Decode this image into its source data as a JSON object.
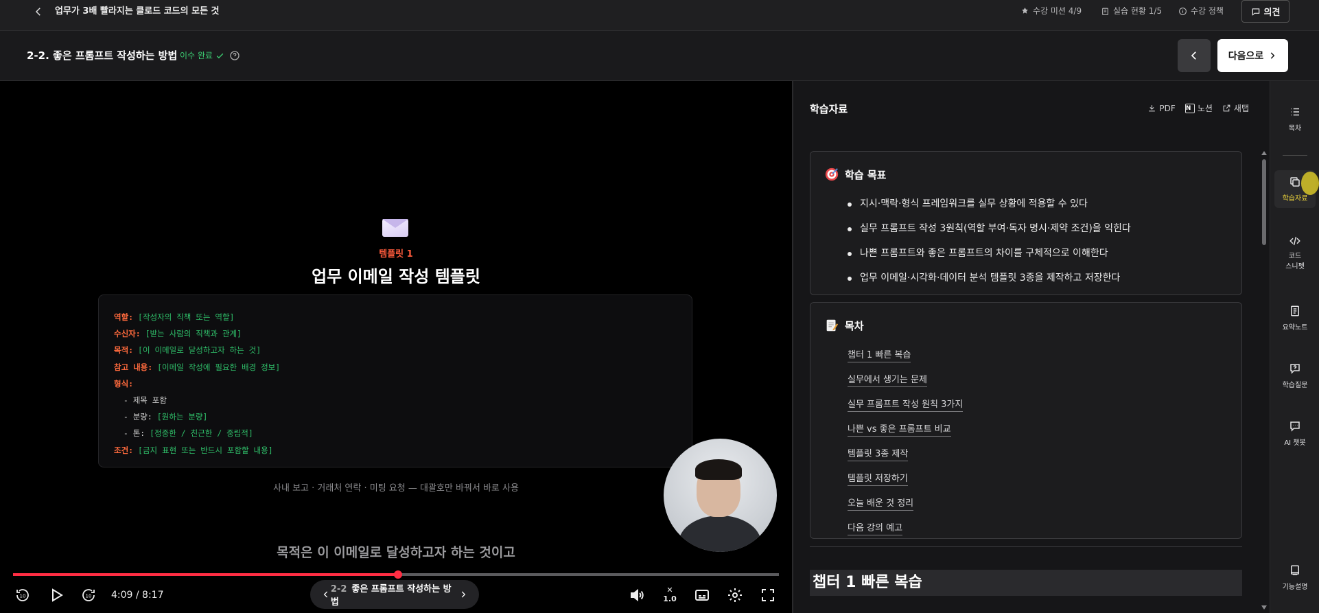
{
  "topbar": {
    "course_title": "업무가 3배 빨라지는 클로드 코드의 모든 것",
    "mission": "수강 미션 4/9",
    "practice": "실습 현황 1/5",
    "policy": "수강 정책",
    "feedback": "의견"
  },
  "lesson": {
    "title": "2-2. 좋은 프롬프트 작성하는 방법",
    "status": "이수 완료",
    "next_label": "다음으로"
  },
  "video": {
    "template_label": "템플릿 1",
    "template_title": "업무 이메일 작성 템플릿",
    "code_lines": [
      {
        "key": "역할:",
        "value": "[작성자의 직책 또는 역할]"
      },
      {
        "key": "수신자:",
        "value": "[받는 사람의 직책과 관계]"
      },
      {
        "key": "목적:",
        "value": "[이 이메일로 달성하고자 하는 것]"
      },
      {
        "key": "참고 내용:",
        "value": "[이메일 작성에 필요한 배경 정보]"
      },
      {
        "key": "형식:",
        "value": ""
      },
      {
        "key": "",
        "sub": "- 제목 포함",
        "value": ""
      },
      {
        "key": "",
        "sub": "- 분량:",
        "value": "[원하는 분량]"
      },
      {
        "key": "",
        "sub": "- 톤:",
        "value": "[정중한 / 친근한 / 중립적]"
      },
      {
        "key": "조건:",
        "value": "[금지 표현 또는 반드시 포함할 내용]"
      }
    ],
    "usage_caption": "사내 보고 · 거래처 연락 · 미팅 요청 — 대괄호만 바꿔서 바로 사용",
    "subtitle": "목적은 이 이메일로 달성하고자 하는 것이고",
    "time": "4:09 / 8:17",
    "progress": 0.503,
    "chapter_num": "2-2",
    "chapter_name": "좋은 프롬프트 작성하는 방법",
    "speed": "1.0"
  },
  "panel": {
    "title": "학습자료",
    "tools": {
      "pdf": "PDF",
      "notion": "노션",
      "new_window": "새탭"
    },
    "goals_title": "학습 목표",
    "goals": [
      "지시·맥락·형식 프레임워크를 실무 상황에 적용할 수 있다",
      "실무 프롬프트 작성 3원칙(역할 부여·독자 명시·제약 조건)을 익힌다",
      "나쁜 프롬프트와 좋은 프롬프트의 차이를 구체적으로 이해한다",
      "업무 이메일·시각화·데이터 분석 템플릿 3종을 제작하고 저장한다"
    ],
    "toc_title": "목차",
    "toc": [
      "챕터 1 빠른 복습",
      "실무에서 생기는 문제",
      "실무 프롬프트 작성 원칙 3가지",
      "나쁜 vs 좋은 프롬프트 비교",
      "템플릿 3종 제작",
      "템플릿 저장하기",
      "오늘 배운 것 정리",
      "다음 강의 예고"
    ],
    "chapter_heading": "챕터 1 빠른 복습"
  },
  "rail": {
    "toc": "목차",
    "materials": "학습자료",
    "snippet_1": "코드",
    "snippet_2": "스니펫",
    "summary": "요약노트",
    "question": "학습질문",
    "chatbot": "AI 챗봇",
    "guide": "기능설명"
  },
  "colors": {
    "accent_red": "#ff2d43",
    "done_green": "#3ccf73",
    "key_orange": "#ff6a3d",
    "active_yellow": "#f1d83b"
  }
}
